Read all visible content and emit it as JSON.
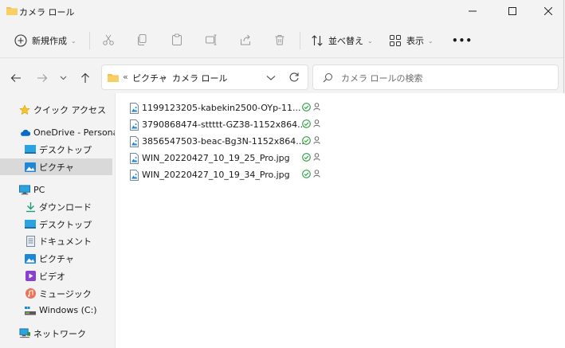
{
  "window": {
    "title": "カメラ ロール"
  },
  "toolbar": {
    "new_label": "新規作成",
    "sort_label": "並べ替え",
    "view_label": "表示",
    "more_label": "•••"
  },
  "address": {
    "overflow": "«",
    "crumbs": [
      "ピクチャ",
      "カメラ ロール"
    ],
    "separator": "›"
  },
  "search": {
    "placeholder": "カメラ ロールの検索"
  },
  "nav": {
    "quick_access": "クイック アクセス",
    "onedrive": "OneDrive - Personal",
    "od_desktop": "デスクトップ",
    "od_pictures": "ピクチャ",
    "pc": "PC",
    "downloads": "ダウンロード",
    "desktop": "デスクトップ",
    "documents": "ドキュメント",
    "pictures": "ピクチャ",
    "videos": "ビデオ",
    "music": "ミュージック",
    "windows_c": "Windows (C:)",
    "network": "ネットワーク"
  },
  "files": [
    "1199123205-kabekin2500-OYp-11...",
    "3790868474-sttttt-GZ38-1152x864...",
    "3856547503-beac-Bg3N-1152x864...",
    "WIN_20220427_10_19_25_Pro.jpg",
    "WIN_20220427_10_19_34_Pro.jpg"
  ],
  "colors": {
    "accent": "#0067c0",
    "folder": "#f5c04a",
    "sync_ok": "#2e9e44",
    "selected_bg": "#d9d9d9"
  }
}
